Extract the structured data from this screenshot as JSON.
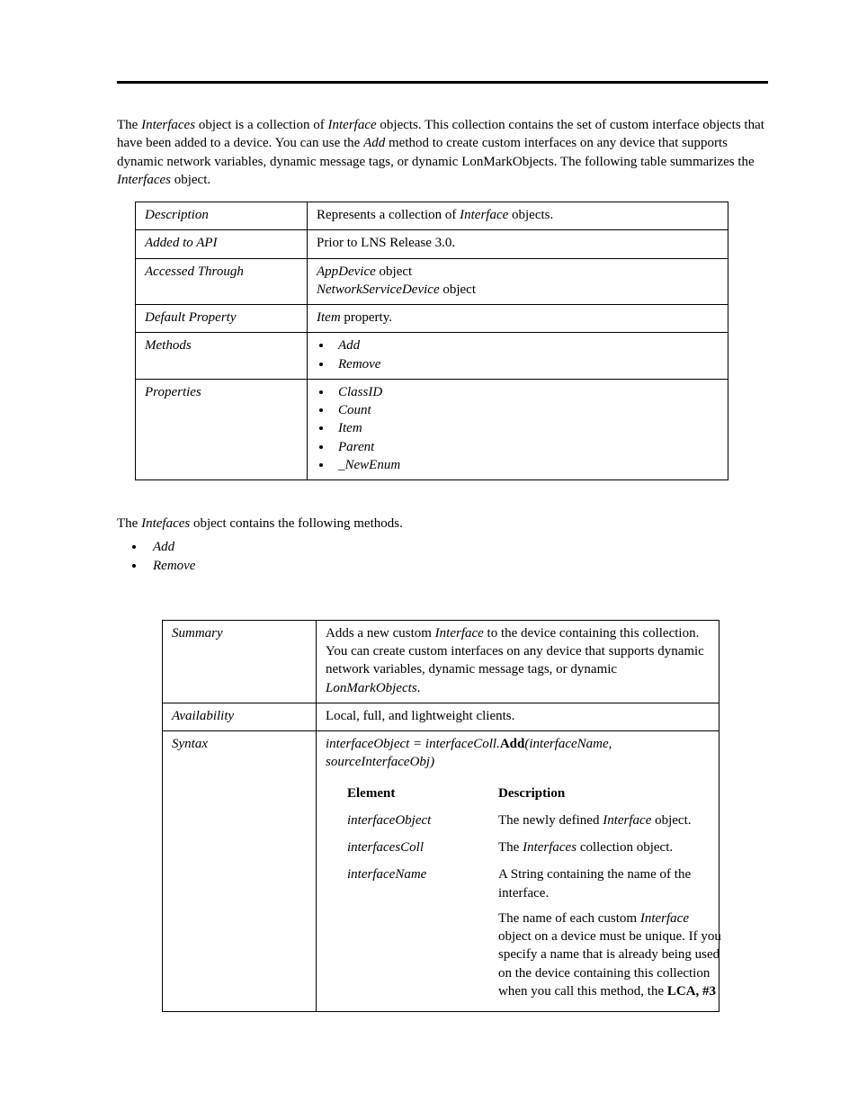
{
  "intro": {
    "p1_a": "The ",
    "p1_b": "Interfaces",
    "p1_c": " object is a collection of ",
    "p1_d": "Interface",
    "p1_e": " objects.  This collection contains the set of custom interface objects that have been added to a device. You can use the ",
    "p1_f": "Add",
    "p1_g": " method to create custom interfaces on any device that supports dynamic network variables, dynamic message tags, or dynamic LonMarkObjects.  The following table summarizes the ",
    "p1_h": "Interfaces",
    "p1_i": " object."
  },
  "tbl1": {
    "r1": {
      "label": "Description",
      "val_a": "Represents a collection of ",
      "val_b": "Interface",
      "val_c": " objects."
    },
    "r2": {
      "label": "Added to API",
      "val": "Prior to LNS Release 3.0."
    },
    "r3": {
      "label": "Accessed Through",
      "v1_a": "AppDevice",
      "v1_b": " object",
      "v2_a": "NetworkServiceDevice",
      "v2_b": " object"
    },
    "r4": {
      "label": "Default Property",
      "val_a": "Item",
      "val_b": " property."
    },
    "r5": {
      "label": "Methods",
      "items": [
        "Add",
        "Remove"
      ]
    },
    "r6": {
      "label": "Properties",
      "items": [
        "ClassID",
        "Count",
        "Item",
        "Parent",
        "_NewEnum"
      ]
    }
  },
  "methods_line": {
    "a": "The ",
    "b": "Intefaces",
    "c": " object contains the following methods."
  },
  "outer_methods": [
    "Add",
    "Remove"
  ],
  "tbl2": {
    "r1": {
      "label": "Summary",
      "a": "Adds a new custom ",
      "b": "Interface",
      "c": " to the device containing this collection. You can create custom interfaces on any device that supports dynamic network variables, dynamic message tags, or dynamic ",
      "d": "LonMarkObjects",
      "e": "."
    },
    "r2": {
      "label": "Availability",
      "val": "Local, full, and lightweight clients."
    },
    "r3": {
      "label": "Syntax",
      "expr_a": "interfaceObject = interfaceColl.",
      "expr_b": "Add",
      "expr_c": "(interfaceName, sourceInterfaceObj)",
      "head_el": "Element",
      "head_desc": "Description",
      "rows": [
        {
          "el": "interfaceObject",
          "d1_a": "The newly defined ",
          "d1_b": "Interface",
          "d1_c": " object."
        },
        {
          "el": "interfacesColl",
          "d1_a": "The ",
          "d1_b": "Interfaces",
          "d1_c": "  collection object."
        },
        {
          "el": "interfaceName",
          "d1": "A String containing the name of the interface.",
          "d2_a": "The name of each custom ",
          "d2_b": "Interface",
          "d2_c": " object on a device must be unique. If you specify a name that is already being used on the device containing this collection when you call this method, the ",
          "d2_d": "LCA, #3"
        }
      ]
    }
  }
}
